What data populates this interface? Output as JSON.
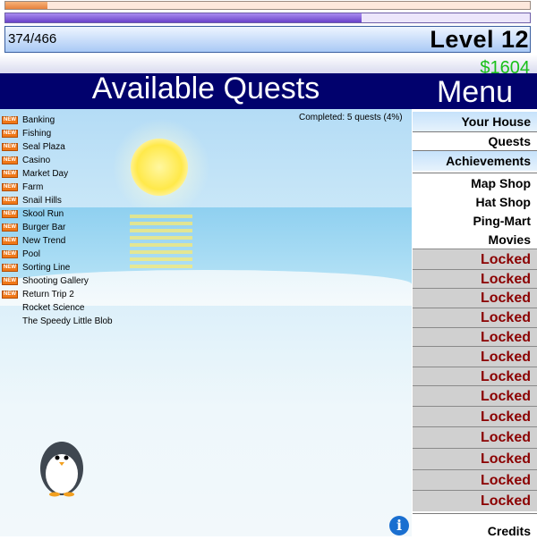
{
  "stats": {
    "health_fraction": 0.08,
    "energy_fraction": 0.68,
    "xp_text": "374/466",
    "xp_fraction": 0.8,
    "level_text": "Level 12",
    "money": "$1604"
  },
  "header": {
    "quests_title": "Available Quests",
    "menu_title": "Menu"
  },
  "quests": {
    "completed_text": "Completed: 5 quests (4%)",
    "new_badge": "NEW",
    "items": [
      {
        "label": "Banking",
        "is_new": true
      },
      {
        "label": "Fishing",
        "is_new": true
      },
      {
        "label": "Seal Plaza",
        "is_new": true
      },
      {
        "label": "Casino",
        "is_new": true
      },
      {
        "label": "Market Day",
        "is_new": true
      },
      {
        "label": "Farm",
        "is_new": true
      },
      {
        "label": "Snail Hills",
        "is_new": true
      },
      {
        "label": "Skool Run",
        "is_new": true
      },
      {
        "label": "Burger Bar",
        "is_new": true
      },
      {
        "label": "New Trend",
        "is_new": true
      },
      {
        "label": "Pool",
        "is_new": true
      },
      {
        "label": "Sorting Line",
        "is_new": true
      },
      {
        "label": "Shooting Gallery",
        "is_new": true
      },
      {
        "label": "Return Trip 2",
        "is_new": true
      },
      {
        "label": "Rocket Science",
        "is_new": false
      },
      {
        "label": "The Speedy Little Blob",
        "is_new": false
      }
    ]
  },
  "menu": {
    "items": [
      {
        "label": "Your House",
        "state": "open"
      },
      {
        "label": "Quests",
        "state": "open"
      },
      {
        "label": "Achievements",
        "state": "open"
      },
      {
        "label": "Map Shop",
        "state": "open"
      },
      {
        "label": "Hat Shop",
        "state": "open"
      },
      {
        "label": "Ping-Mart",
        "state": "open"
      },
      {
        "label": "Movies",
        "state": "open"
      },
      {
        "label": "Locked",
        "state": "locked"
      },
      {
        "label": "Locked",
        "state": "locked"
      },
      {
        "label": "Locked",
        "state": "locked"
      },
      {
        "label": "Locked",
        "state": "locked"
      },
      {
        "label": "Locked",
        "state": "locked"
      },
      {
        "label": "Locked",
        "state": "locked"
      },
      {
        "label": "Locked",
        "state": "locked"
      },
      {
        "label": "Locked",
        "state": "locked"
      },
      {
        "label": "Locked",
        "state": "locked"
      },
      {
        "label": "Locked",
        "state": "locked"
      },
      {
        "label": "Locked",
        "state": "locked"
      },
      {
        "label": "Locked",
        "state": "locked"
      },
      {
        "label": "Locked",
        "state": "locked"
      },
      {
        "label": "Credits",
        "state": "open"
      }
    ]
  },
  "icons": {
    "info": "info-icon",
    "character": "penguin-icon"
  },
  "colors": {
    "header_bg": "#01016d",
    "money": "#19c019",
    "locked_text": "#8b0000",
    "locked_bg": "#d0d0d0"
  }
}
